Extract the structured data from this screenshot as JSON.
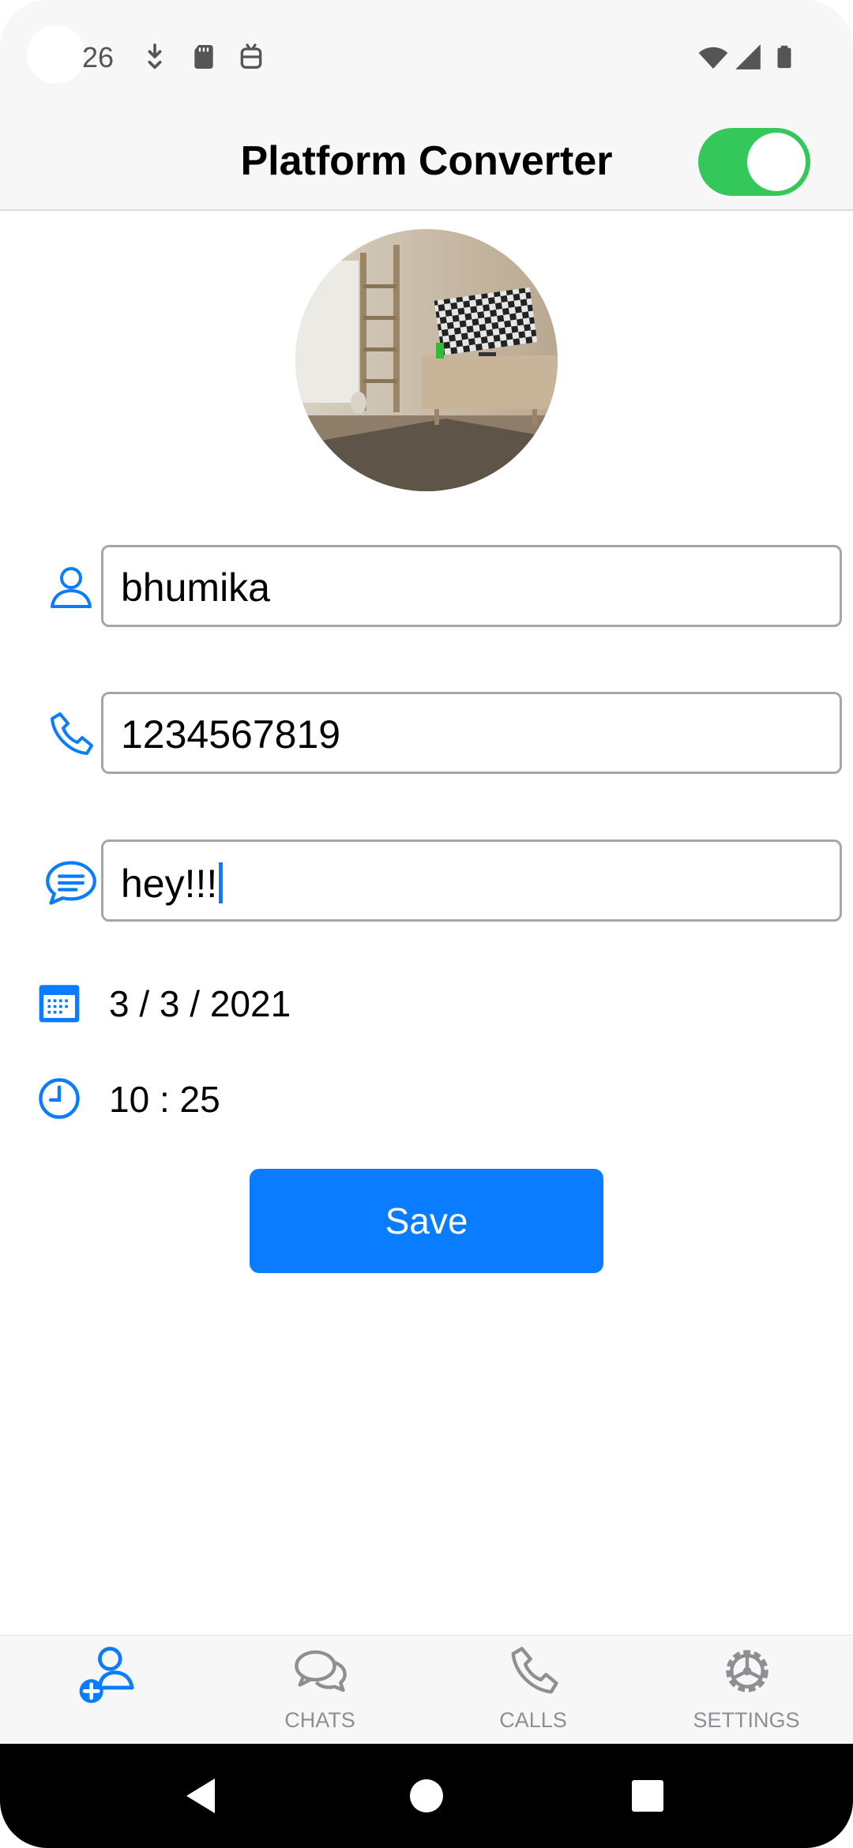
{
  "status_bar": {
    "time": "26"
  },
  "header": {
    "title": "Platform Converter",
    "toggle_on": true
  },
  "form": {
    "name_value": "bhumika",
    "phone_value": "1234567819",
    "message_value": "hey!!!",
    "date_value": "3 / 3 / 2021",
    "time_value": "10 : 25",
    "save_label": "Save"
  },
  "tabs": [
    {
      "label": "",
      "icon": "add-contact-icon",
      "active": true
    },
    {
      "label": "CHATS",
      "icon": "chats-icon",
      "active": false
    },
    {
      "label": "CALLS",
      "icon": "calls-icon",
      "active": false
    },
    {
      "label": "SETTINGS",
      "icon": "settings-icon",
      "active": false
    }
  ],
  "colors": {
    "accent": "#0a7cff",
    "toggle_on": "#34c759",
    "inactive_tab": "#8e8e93"
  }
}
